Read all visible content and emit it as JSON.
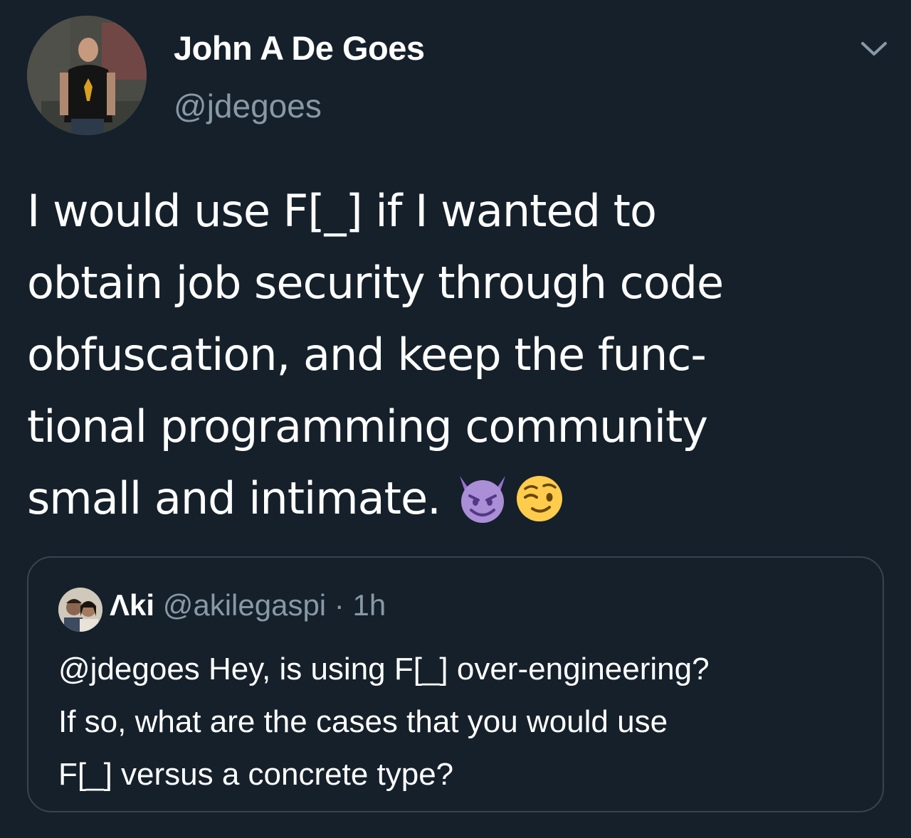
{
  "author": {
    "name": "John A De Goes",
    "handle": "@jdegoes"
  },
  "tweet": {
    "lines": [
      "I would use F[_] if I wanted to",
      "obtain job security through code",
      "obfuscation, and keep the func-",
      "tional programming community",
      "small and intimate. "
    ],
    "emojis": [
      "smiling-imp",
      "winking-face"
    ]
  },
  "quoted": {
    "name": "Λki",
    "handle": "@akilegaspi",
    "separator": " · ",
    "time": "1h",
    "lines": [
      "@jdegoes Hey, is using F[_] over-engineering?",
      "If so, what are the cases that you would use",
      "F[_] versus a concrete type?"
    ]
  },
  "icons": {
    "menu": "chevron-down-icon"
  },
  "colors": {
    "background": "#15202b",
    "text": "#ffffff",
    "secondary_text": "#8899a6",
    "quote_border": "#38444d"
  }
}
